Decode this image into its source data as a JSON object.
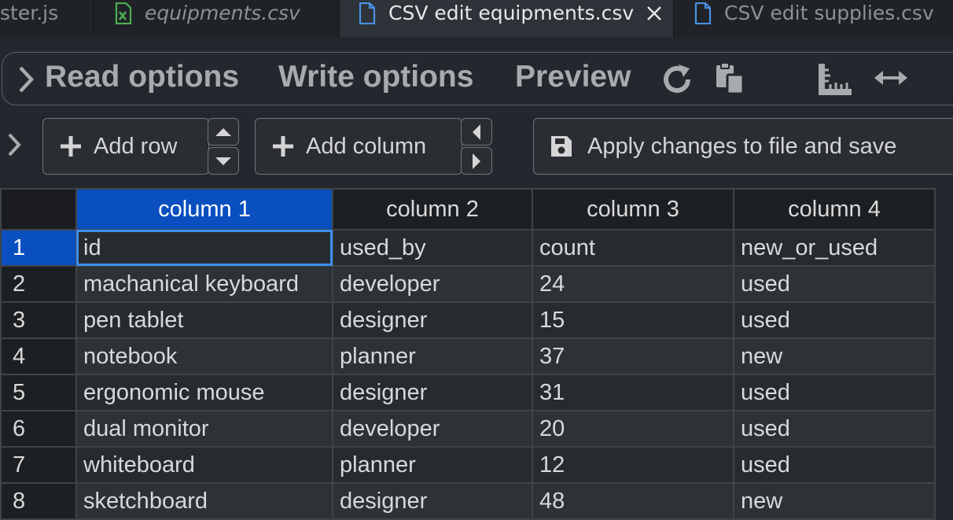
{
  "tabs": [
    {
      "label": "ster.js",
      "italic": false,
      "active": false
    },
    {
      "label": "equipments.csv",
      "italic": true,
      "active": false
    },
    {
      "label": "CSV edit equipments.csv",
      "italic": false,
      "active": true
    },
    {
      "label": "CSV edit supplies.csv",
      "italic": false,
      "active": false
    }
  ],
  "options": {
    "read_label": "Read options",
    "write_label": "Write options",
    "preview_label": "Preview"
  },
  "actions": {
    "add_row_label": "Add row",
    "add_column_label": "Add column",
    "apply_label": "Apply changes to file and save"
  },
  "table": {
    "headers": [
      "column 1",
      "column 2",
      "column 3",
      "column 4"
    ],
    "rows": [
      {
        "num": "1",
        "cells": [
          "id",
          "used_by",
          "count",
          "new_or_used"
        ]
      },
      {
        "num": "2",
        "cells": [
          "machanical keyboard",
          "developer",
          "24",
          "used"
        ]
      },
      {
        "num": "3",
        "cells": [
          "pen tablet",
          "designer",
          "15",
          "used"
        ]
      },
      {
        "num": "4",
        "cells": [
          "notebook",
          "planner",
          "37",
          "new"
        ]
      },
      {
        "num": "5",
        "cells": [
          "ergonomic mouse",
          "designer",
          "31",
          "used"
        ]
      },
      {
        "num": "6",
        "cells": [
          "dual monitor",
          "developer",
          "20",
          "used"
        ]
      },
      {
        "num": "7",
        "cells": [
          "whiteboard",
          "planner",
          "12",
          "used"
        ]
      },
      {
        "num": "8",
        "cells": [
          "sketchboard",
          "designer",
          "48",
          "new"
        ]
      }
    ]
  },
  "colors": {
    "accent": "#0a4fbf",
    "focus": "#3e8ef7",
    "csv_icon": "#4caf50",
    "file_icon": "#4a90e2"
  }
}
